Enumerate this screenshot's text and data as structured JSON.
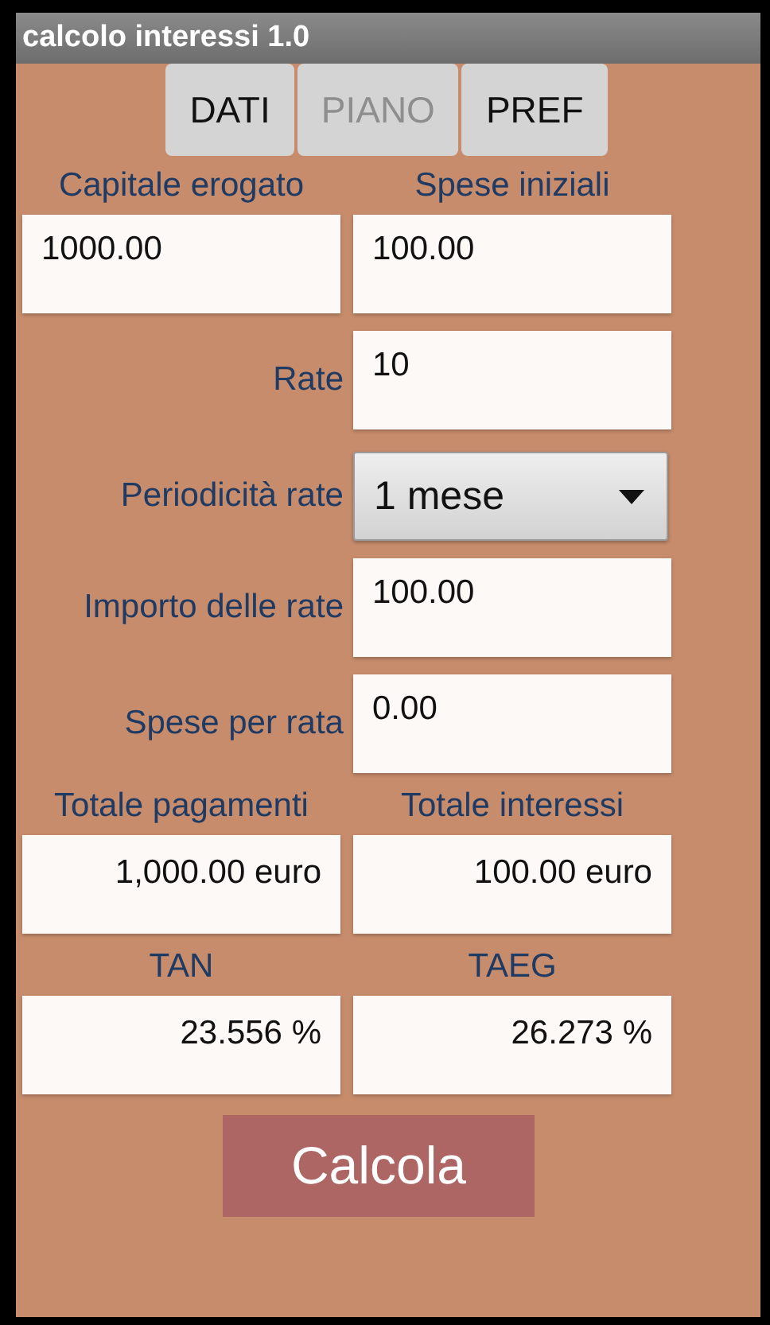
{
  "window": {
    "title": "calcolo interessi 1.0"
  },
  "tabs": [
    {
      "label": "DATI",
      "disabled": false
    },
    {
      "label": "PIANO",
      "disabled": true
    },
    {
      "label": "PREF",
      "disabled": false
    }
  ],
  "sections": [
    {
      "kind": "pair",
      "items": [
        {
          "kind": "input",
          "label": "Capitale erogato",
          "value": "1000.00"
        },
        {
          "kind": "input",
          "label": "Spese iniziali",
          "value": "100.00"
        }
      ]
    },
    {
      "kind": "input_row",
      "label": "Rate",
      "value": "10"
    },
    {
      "kind": "dropdown_row",
      "label": "Periodicità rate",
      "value": "1 mese"
    },
    {
      "kind": "input_row",
      "label": "Importo delle rate",
      "value": "100.00"
    },
    {
      "kind": "input_row",
      "label": "Spese per rata",
      "value": "0.00"
    },
    {
      "kind": "pair",
      "items": [
        {
          "kind": "output",
          "label": "Totale pagamenti",
          "value": "1,000.00 euro"
        },
        {
          "kind": "output",
          "label": "Totale interessi",
          "value": "100.00 euro"
        }
      ]
    },
    {
      "kind": "pair",
      "items": [
        {
          "kind": "output",
          "label": "TAN",
          "value": "23.556 %"
        },
        {
          "kind": "output",
          "label": "TAEG",
          "value": "26.273 %"
        }
      ]
    }
  ],
  "button": {
    "label": "Calcola"
  }
}
